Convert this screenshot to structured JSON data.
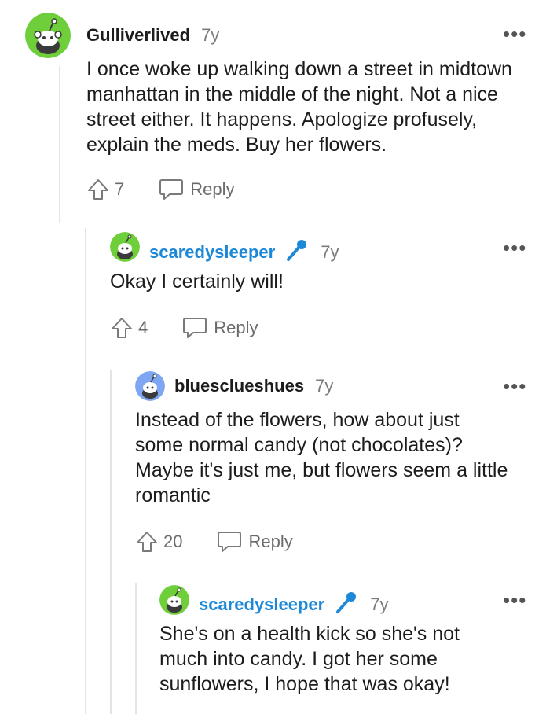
{
  "comments": [
    {
      "username": "Gulliverlived",
      "age": "7y",
      "more": "•••",
      "body": "I once woke up walking down a street in midtown manhattan in the middle of the night. Not a nice street either. It happens. Apologize profusely, explain the meds. Buy her flowers.",
      "votes": "7",
      "reply_label": "Reply",
      "avatar_color": "#6fcf3b",
      "is_op": false
    },
    {
      "username": "scaredysleeper",
      "age": "7y",
      "more": "•••",
      "body": "Okay I certainly will!",
      "votes": "4",
      "reply_label": "Reply",
      "avatar_color": "#6fcf3b",
      "is_op": true
    },
    {
      "username": "bluesclueshues",
      "age": "7y",
      "more": "•••",
      "body": "Instead of the flowers, how about just some normal candy (not chocolates)? Maybe it's just me, but flowers seem a little romantic",
      "votes": "20",
      "reply_label": "Reply",
      "avatar_color": "#7fa6f2",
      "is_op": false
    },
    {
      "username": "scaredysleeper",
      "age": "7y",
      "more": "•••",
      "body": "She's on a health kick so she's not much into candy. I got her some sunflowers, I hope that was okay!",
      "is_op": true,
      "avatar_color": "#6fcf3b"
    }
  ],
  "colors": {
    "op_username": "#1e88d8",
    "thread_line": "#e4e4e4",
    "muted": "#7c7c7c"
  },
  "icons": [
    "snoo-avatar-icon",
    "microphone-icon",
    "upvote-arrow-icon",
    "comment-bubble-icon",
    "more-options-icon"
  ]
}
